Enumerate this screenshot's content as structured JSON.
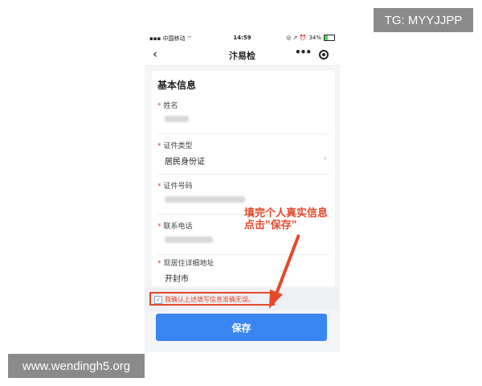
{
  "watermarks": {
    "tg": "TG: MYYJJPP",
    "site": "www.wendingh5.org"
  },
  "status_bar": {
    "carrier": "中国移动",
    "time": "14:59",
    "battery": "34%",
    "battery_level": 0.34
  },
  "nav": {
    "title": "汴易检",
    "more_icon": "more-dots-icon",
    "target_icon": "target-icon"
  },
  "form": {
    "section_title": "基本信息",
    "fields": [
      {
        "label": "姓名",
        "value": ""
      },
      {
        "label": "证件类型",
        "value": "居民身份证"
      },
      {
        "label": "证件号码",
        "value": ""
      },
      {
        "label": "联系电话",
        "value": ""
      },
      {
        "label": "现居住详细地址",
        "value": "开封市"
      }
    ]
  },
  "consent": {
    "text": "我确认上述填写信息准确无误。",
    "checked": true
  },
  "save_button": "保存",
  "annotation": {
    "line1": "填完个人真实信息",
    "line2": "点击\"保存\""
  },
  "colors": {
    "accent": "#3a86f0",
    "annotation": "#e24a2b"
  }
}
